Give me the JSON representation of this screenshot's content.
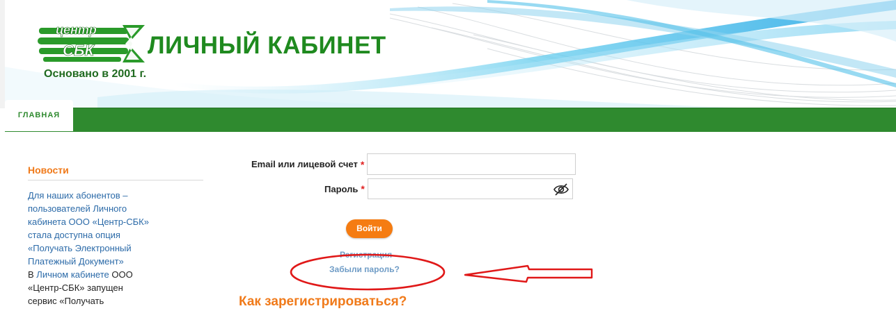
{
  "header": {
    "logo_top": "центр",
    "logo_bottom": "СБК",
    "title": "ЛИЧНЫЙ КАБИНЕТ",
    "founded": "Основано в 2001 г."
  },
  "nav": {
    "tabs": [
      {
        "label": "ГЛАВНАЯ",
        "active": true
      }
    ]
  },
  "sidebar": {
    "news_title": "Новости",
    "news_item_1": "Для наших абонентов – пользователей Личного кабинета ООО «Центр-СБК» стала доступна опция «Получать Электронный Платежный Документ»",
    "news_item_2_prefix": "В ",
    "news_item_2_link": "Личном кабинете",
    "news_item_2_rest": " ООО «Центр-СБК» запущен сервис «Получать"
  },
  "login_form": {
    "email_label": "Email или лицевой счет",
    "email_value": "",
    "password_label": "Пароль",
    "password_value": "",
    "required_mark": "*",
    "submit_label": "Войти",
    "register_link": "Регистрация",
    "forgot_link": "Забыли пароль?",
    "eye_icon": "eye-slash-icon"
  },
  "how_to": {
    "heading": "Как зарегистрироваться?"
  },
  "colors": {
    "brand_green": "#2f8a2f",
    "accent_orange": "#f57c12",
    "link_blue": "#2b6aa8",
    "annotation_red": "#e01818"
  }
}
